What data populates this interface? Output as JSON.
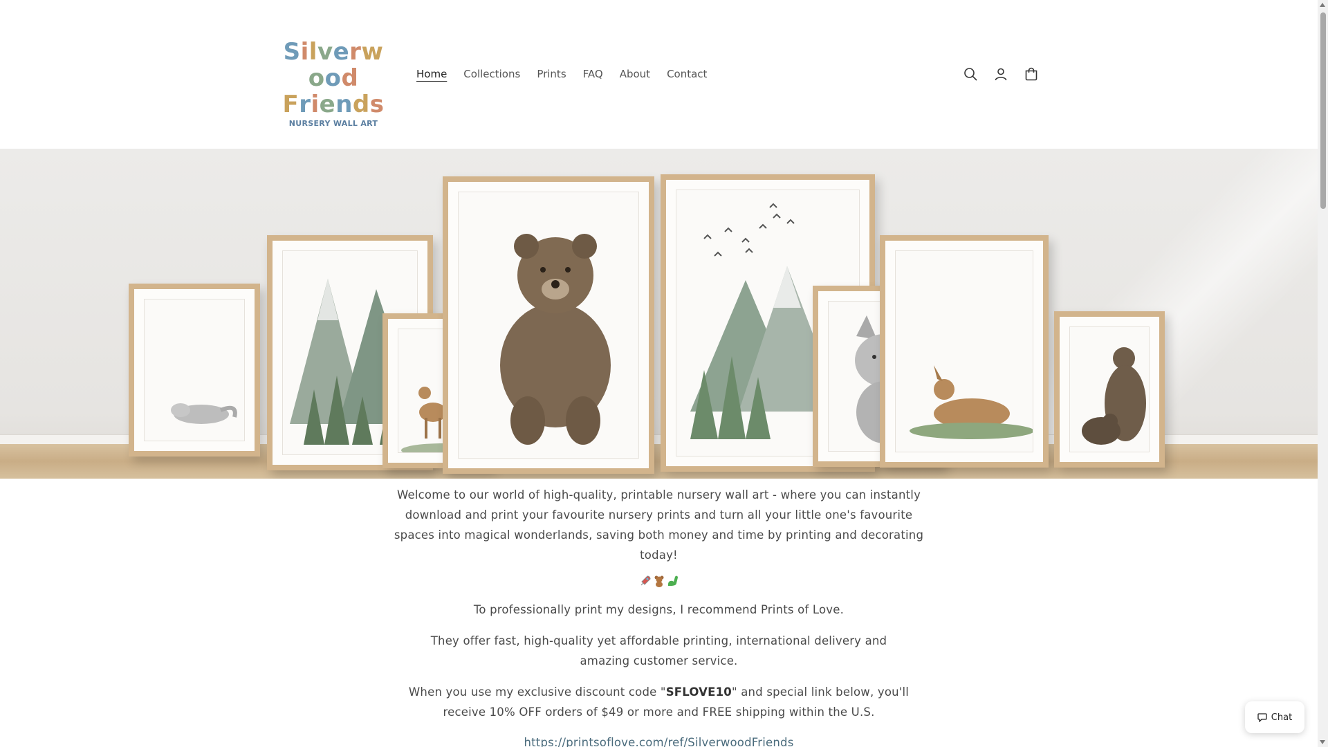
{
  "brand": {
    "logo_line1": "Silverwood",
    "logo_line2": "Friends",
    "logo_sub": "NURSERY WALL ART"
  },
  "nav": {
    "items": [
      {
        "label": "Home",
        "active": true
      },
      {
        "label": "Collections",
        "active": false
      },
      {
        "label": "Prints",
        "active": false
      },
      {
        "label": "FAQ",
        "active": false
      },
      {
        "label": "About",
        "active": false
      },
      {
        "label": "Contact",
        "active": false
      }
    ]
  },
  "header_icons": [
    "search-icon",
    "account-icon",
    "cart-icon"
  ],
  "hero": {
    "description": "",
    "colors": {
      "frame": "#d2b48c",
      "wall": "#ecebe9",
      "floor": "#c9ad86"
    }
  },
  "content": {
    "welcome": "Welcome to our world of high-quality, printable nursery wall art - where you can instantly download and print your favourite nursery prints and turn all your little one's favourite spaces into magical wonderlands, saving both money and time by printing and decorating today!",
    "emojis": [
      "rocket",
      "teddy-bear",
      "dinosaur"
    ],
    "recommend": "To professionally print my designs, I recommend Prints of Love.",
    "offer": "They offer fast, high-quality yet affordable printing, international delivery and amazing customer service.",
    "discount_prefix": "When you use my exclusive discount code \"",
    "discount_code": "SFLOVE10",
    "discount_suffix": "\" and special link below, you'll receive 10% OFF orders of $49 or more and FREE shipping within the U.S.",
    "link": "https://printsoflove.com/ref/SilverwoodFriends"
  },
  "chat": {
    "label": "Chat"
  },
  "colors": {
    "text": "#4a4a4a",
    "link": "#4a6b7c",
    "nav_active": "#222222"
  }
}
